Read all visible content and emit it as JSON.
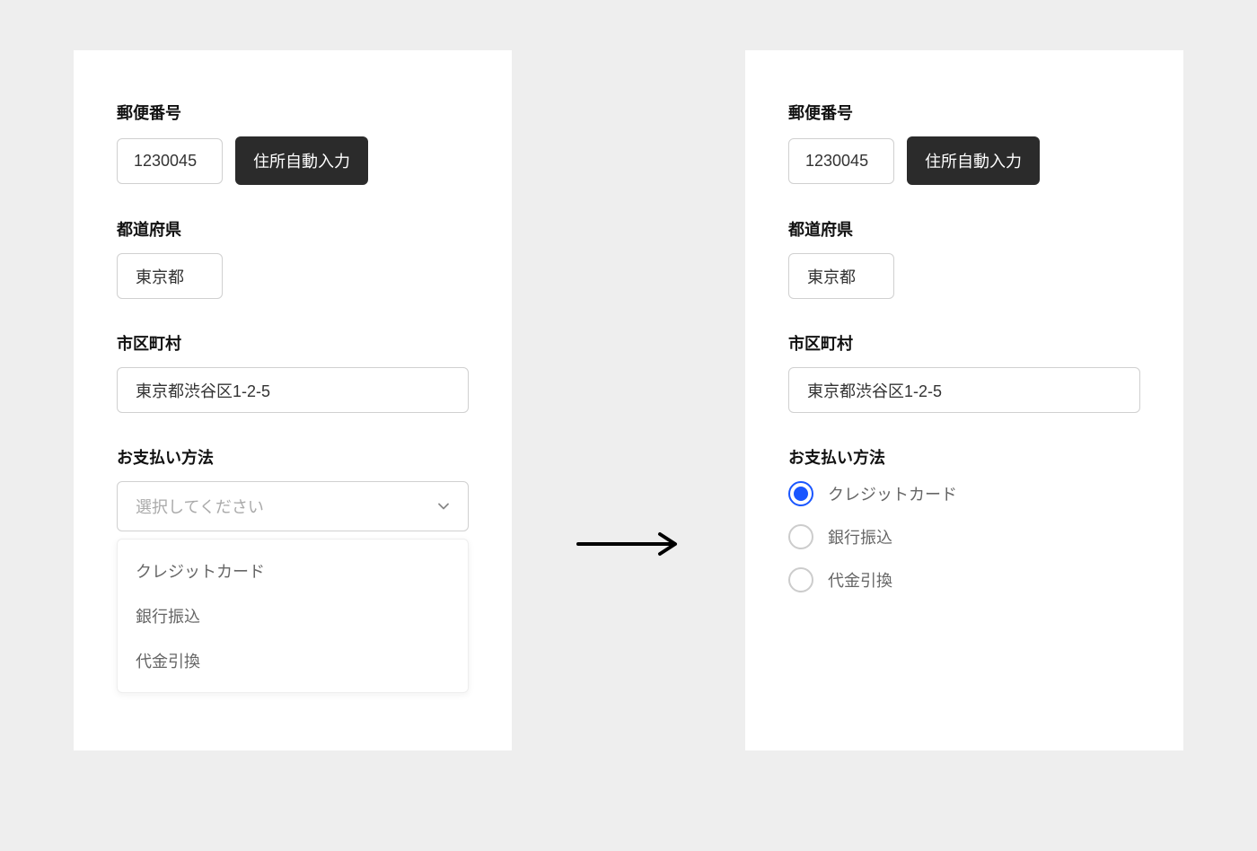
{
  "left": {
    "postal": {
      "label": "郵便番号",
      "value": "1230045",
      "button": "住所自動入力"
    },
    "prefecture": {
      "label": "都道府県",
      "value": "東京都"
    },
    "city": {
      "label": "市区町村",
      "value": "東京都渋谷区1-2-5"
    },
    "payment": {
      "label": "お支払い方法",
      "placeholder": "選択してください",
      "options": [
        "クレジットカード",
        "銀行振込",
        "代金引換"
      ]
    }
  },
  "right": {
    "postal": {
      "label": "郵便番号",
      "value": "1230045",
      "button": "住所自動入力"
    },
    "prefecture": {
      "label": "都道府県",
      "value": "東京都"
    },
    "city": {
      "label": "市区町村",
      "value": "東京都渋谷区1-2-5"
    },
    "payment": {
      "label": "お支払い方法",
      "options": [
        "クレジットカード",
        "銀行振込",
        "代金引換"
      ],
      "selected_index": 0
    }
  }
}
